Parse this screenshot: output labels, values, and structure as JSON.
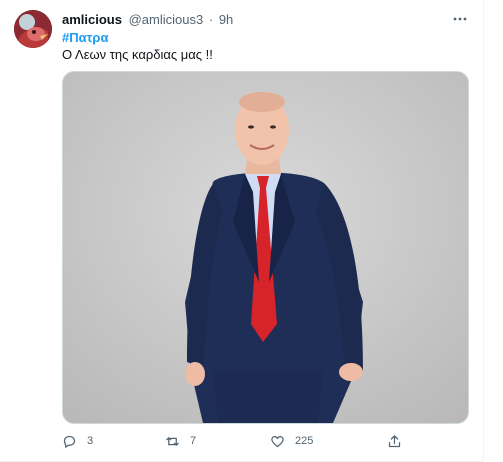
{
  "tweet": {
    "display_name": "amlicious",
    "handle": "@amlicious3",
    "separator": "·",
    "time": "9h",
    "hashtag": "#Πατρα",
    "text": "Ο Λεων της καρδιας μας !!",
    "media": {
      "icon": "photo",
      "description_hidden": true
    },
    "actions": {
      "reply_count": "3",
      "retweet_count": "7",
      "like_count": "225"
    }
  },
  "colors": {
    "link": "#1d9bf0",
    "secondary_text": "#536471",
    "primary_text": "#0f1419",
    "border": "#cfd9de"
  },
  "icons": {
    "more": "more-horizontal-icon",
    "reply": "reply-icon",
    "retweet": "retweet-icon",
    "like": "heart-icon",
    "share": "share-icon"
  }
}
